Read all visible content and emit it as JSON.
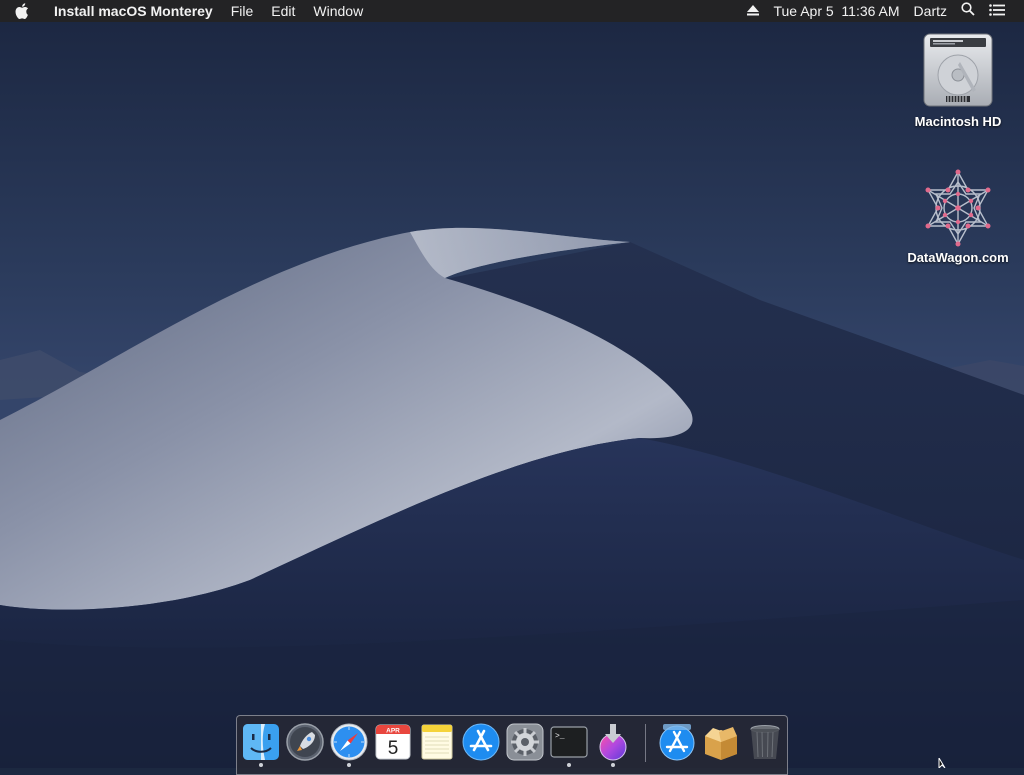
{
  "menubar": {
    "apple_icon": "apple-logo-icon",
    "app_name": "Install macOS Monterey",
    "menus": [
      {
        "label": "File"
      },
      {
        "label": "Edit"
      },
      {
        "label": "Window"
      }
    ],
    "status": {
      "eject_icon": "eject-icon",
      "datetime": "Tue Apr 5  11:36 AM",
      "user": "Dartz",
      "spotlight_icon": "search-icon",
      "notification_icon": "list-icon"
    }
  },
  "desktop": {
    "icons": [
      {
        "label": "Macintosh HD",
        "icon": "hard-drive-icon"
      },
      {
        "label": "DataWagon.com",
        "icon": "datawagon-logo-icon"
      }
    ]
  },
  "dock": {
    "items": [
      {
        "name": "Finder",
        "icon": "finder-icon",
        "running": true
      },
      {
        "name": "Launchpad",
        "icon": "rocket-icon",
        "running": false
      },
      {
        "name": "Safari",
        "icon": "compass-icon",
        "running": true
      },
      {
        "name": "Calendar",
        "icon": "calendar-icon",
        "running": false,
        "month": "APR",
        "day": "5"
      },
      {
        "name": "Notes",
        "icon": "notes-icon",
        "running": false
      },
      {
        "name": "App Store",
        "icon": "app-store-icon",
        "running": false
      },
      {
        "name": "System Preferences",
        "icon": "gear-icon",
        "running": false
      },
      {
        "name": "Terminal",
        "icon": "terminal-icon",
        "running": true,
        "prompt": ">_"
      },
      {
        "name": "Install macOS Monterey",
        "icon": "installer-icon",
        "running": true
      },
      {
        "name": "App Store Download",
        "icon": "app-store-folder-icon",
        "running": false
      },
      {
        "name": "Package",
        "icon": "package-icon",
        "running": false
      },
      {
        "name": "Trash",
        "icon": "trash-icon",
        "running": false
      }
    ]
  },
  "colors": {
    "menubar_bg": "#232325",
    "sky_top": "#1c2840",
    "dune_light": "#9aa2b6",
    "dune_shadow": "#1c2746",
    "accent_blue": "#1e8cf0"
  }
}
